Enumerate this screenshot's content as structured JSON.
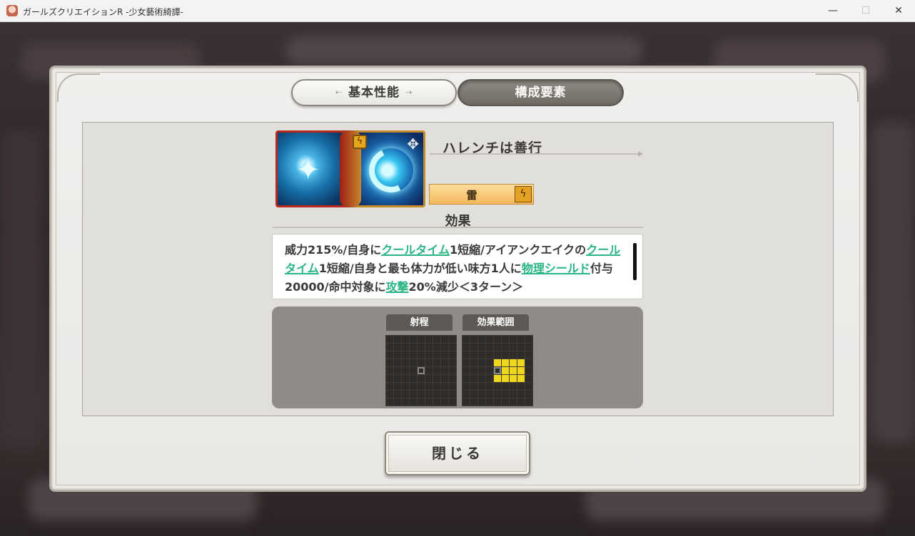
{
  "window": {
    "title": "ガールズクリエイションR -少女藝術綺譚-",
    "minimize": "—",
    "maximize": "☐",
    "close": "✕"
  },
  "tabs": {
    "basic": "基本性能",
    "composition": "構成要素",
    "active": "構成要素"
  },
  "skill": {
    "name": "ハレンチは善行",
    "attribute": "雷",
    "attribute_icon": "lightning-icon"
  },
  "effect": {
    "heading": "効果",
    "segments": [
      {
        "text": "威力215%/自身に",
        "keyword": false
      },
      {
        "text": "クールタイム",
        "keyword": true
      },
      {
        "text": "1短縮/アイアンクエイクの",
        "keyword": false
      },
      {
        "text": "クールタイム",
        "keyword": true
      },
      {
        "text": "1短縮/自身と最も体力が低い味方1人に",
        "keyword": false
      },
      {
        "text": "物理シールド",
        "keyword": true
      },
      {
        "text": "付与20000/命中対象に",
        "keyword": false
      },
      {
        "text": "攻撃",
        "keyword": true
      },
      {
        "text": "20%減少＜3ターン＞",
        "keyword": false
      }
    ]
  },
  "range": {
    "range_label": "射程",
    "area_label": "効果範囲",
    "rows": 9,
    "cols": 9,
    "range_center": [
      4,
      4
    ],
    "area_center": [
      4,
      4
    ],
    "area_cells": [
      [
        3,
        4
      ],
      [
        3,
        5
      ],
      [
        3,
        6
      ],
      [
        3,
        7
      ],
      [
        4,
        5
      ],
      [
        4,
        6
      ],
      [
        4,
        7
      ],
      [
        5,
        4
      ],
      [
        5,
        5
      ],
      [
        5,
        6
      ],
      [
        5,
        7
      ]
    ]
  },
  "close_button": "閉じる",
  "colors": {
    "keyword": "#2bb583",
    "attribute_bg": "#f3b85c",
    "area_cell": "#f0d821"
  }
}
